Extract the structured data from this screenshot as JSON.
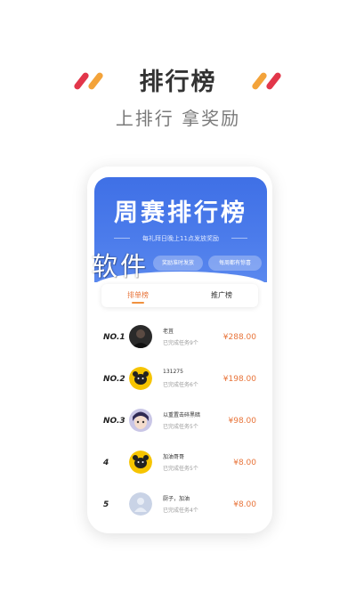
{
  "header": {
    "title": "排行榜",
    "subtitle": "上排行 拿奖励",
    "accent_colors": [
      "#e2364a",
      "#f3a33a"
    ]
  },
  "banner": {
    "title": "周赛排行榜",
    "subtitle": "每礼拜日晚上11点发放奖励",
    "pills": [
      "奖励准时发放",
      "每周都有惊喜"
    ],
    "color": "#4573e8"
  },
  "watermark": "软件",
  "tabs": [
    {
      "label": "排单榜",
      "active": true
    },
    {
      "label": "推广榜",
      "active": false
    }
  ],
  "rankings": [
    {
      "rank": "NO.1",
      "name": "老苴",
      "tasks": "已完成任务9个",
      "amount": "¥288.00",
      "avatar": "dark-photo-avatar"
    },
    {
      "rank": "NO.2",
      "name": "131275",
      "tasks": "已完成任务6个",
      "amount": "¥198.00",
      "avatar": "bear-avatar"
    },
    {
      "rank": "NO.3",
      "name": "以重置击碎黑暗",
      "tasks": "已完成任务5个",
      "amount": "¥98.00",
      "avatar": "anime-avatar"
    },
    {
      "rank": "4",
      "name": "加油哥哥",
      "tasks": "已完成任务5个",
      "amount": "¥8.00",
      "avatar": "bear-avatar"
    },
    {
      "rank": "5",
      "name": "厨子，加油",
      "tasks": "已完成任务4个",
      "amount": "¥8.00",
      "avatar": "pale-avatar"
    }
  ]
}
